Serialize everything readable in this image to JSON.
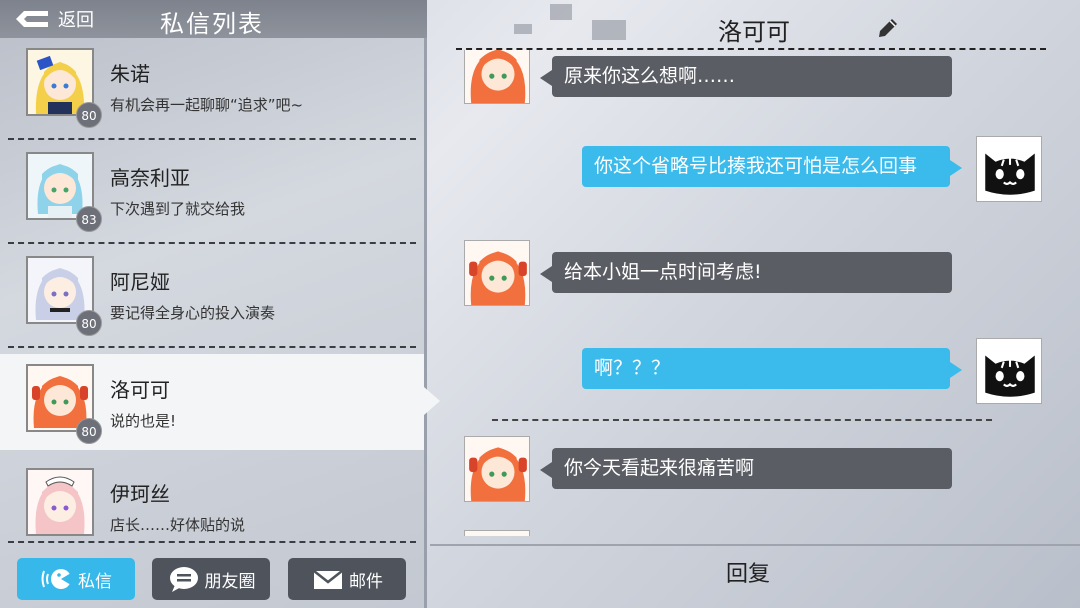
{
  "header": {
    "back_label": "返回",
    "title": "私信列表"
  },
  "chats": [
    {
      "name": "朱诺",
      "preview": "有机会再一起聊聊“追求”吧~",
      "level": "80"
    },
    {
      "name": "高奈利亚",
      "preview": "下次遇到了就交给我",
      "level": "83"
    },
    {
      "name": "阿尼娅",
      "preview": "要记得全身心的投入演奏",
      "level": "80"
    },
    {
      "name": "洛可可",
      "preview": "说的也是!",
      "level": "80"
    },
    {
      "name": "伊珂丝",
      "preview": "店长……好体贴的说",
      "level": ""
    }
  ],
  "tabs": [
    {
      "label": "私信",
      "icon": "chat-mascot-icon"
    },
    {
      "label": "朋友圈",
      "icon": "speech-bubble-icon"
    },
    {
      "label": "邮件",
      "icon": "envelope-icon"
    }
  ],
  "conversation": {
    "contact_name": "洛可可",
    "messages": [
      {
        "from": "contact",
        "text": "原来你这么想啊……"
      },
      {
        "from": "me",
        "text": "你这个省略号比揍我还可怕是怎么回事"
      },
      {
        "from": "contact",
        "text": "给本小姐一点时间考虑!"
      },
      {
        "from": "me",
        "text": "啊？？？"
      },
      {
        "from": "contact",
        "text": "你今天看起来很痛苦啊"
      }
    ],
    "reply_label": "回复"
  },
  "colors": {
    "accent_blue": "#37b8ea",
    "dark_bubble": "#5a5d64",
    "tab_dark": "#4e535c"
  }
}
